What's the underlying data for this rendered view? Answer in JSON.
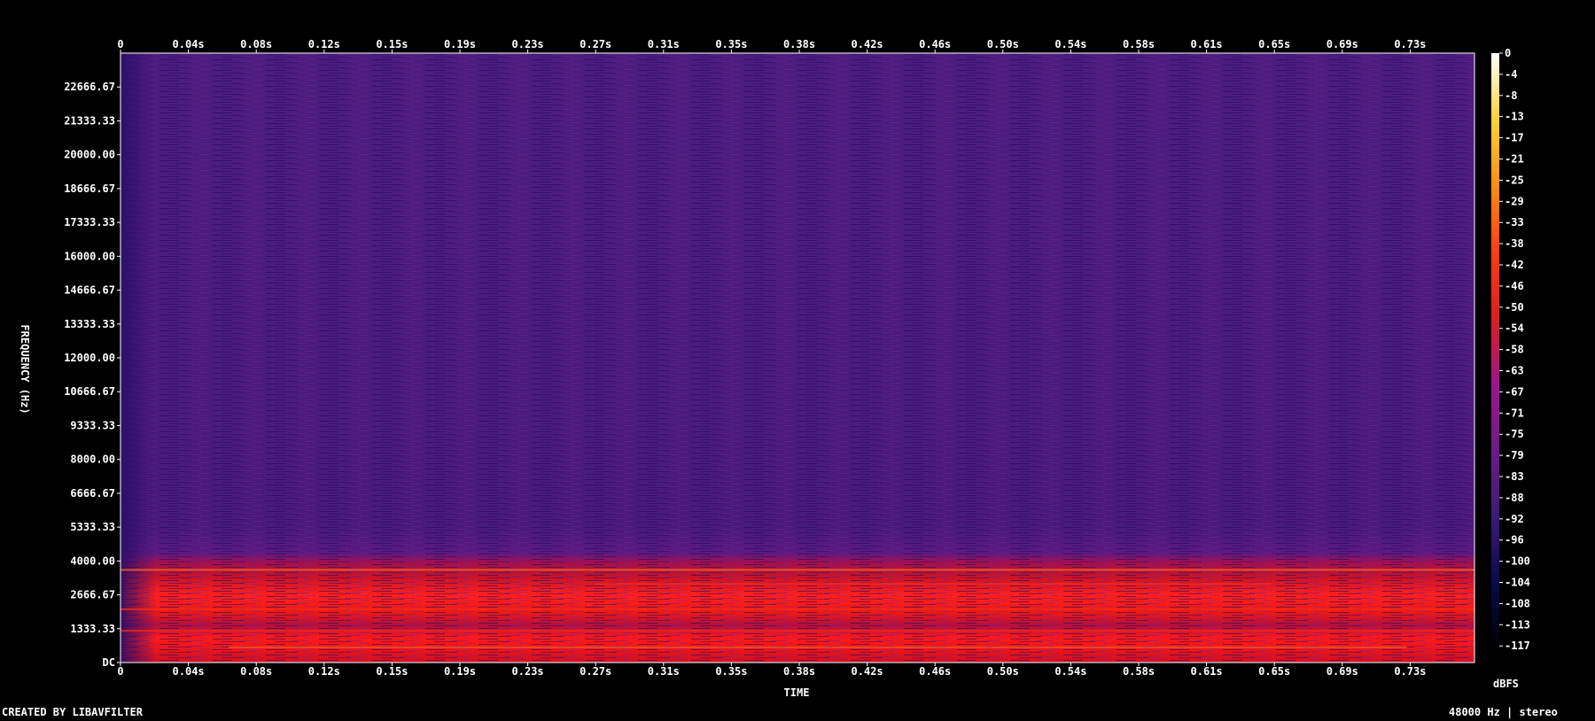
{
  "chart_data": {
    "type": "heatmap",
    "title": "",
    "xlabel": "TIME",
    "ylabel": "FREQUENCY (Hz)",
    "x_ticks": [
      "0",
      "0.04s",
      "0.08s",
      "0.12s",
      "0.15s",
      "0.19s",
      "0.23s",
      "0.27s",
      "0.31s",
      "0.35s",
      "0.38s",
      "0.42s",
      "0.46s",
      "0.50s",
      "0.54s",
      "0.58s",
      "0.61s",
      "0.65s",
      "0.69s",
      "0.73s"
    ],
    "y_ticks": [
      "DC",
      "1333.33",
      "2666.67",
      "4000.00",
      "5333.33",
      "6666.67",
      "8000.00",
      "9333.33",
      "10666.67",
      "12000.00",
      "13333.33",
      "14666.67",
      "16000.00",
      "17333.33",
      "18666.67",
      "20000.00",
      "21333.33",
      "22666.67"
    ],
    "y_range_hz": [
      0,
      24000
    ],
    "colorbar_label": "dBFS",
    "colorbar_ticks": [
      "0",
      "-4",
      "-8",
      "-13",
      "-17",
      "-21",
      "-25",
      "-29",
      "-33",
      "-38",
      "-42",
      "-46",
      "-50",
      "-54",
      "-58",
      "-63",
      "-67",
      "-71",
      "-75",
      "-79",
      "-83",
      "-88",
      "-92",
      "-96",
      "-100",
      "-104",
      "-108",
      "-113",
      "-117"
    ],
    "colorbar_range_dbfs": [
      -120,
      0
    ],
    "colormap": [
      "#000000",
      "#0a0850",
      "#3c1a78",
      "#6e1a8c",
      "#a0148c",
      "#dc1e1e",
      "#ff3c14",
      "#ff8c14",
      "#ffd232",
      "#ffffff"
    ],
    "energy_bands_hz": [
      {
        "from": 0,
        "to": 1000,
        "level_dbfs": -50
      },
      {
        "from": 1000,
        "to": 1500,
        "level_dbfs": -52
      },
      {
        "from": 1500,
        "to": 4000,
        "level_dbfs": -55
      },
      {
        "from": 4000,
        "to": 5300,
        "level_dbfs": -85
      },
      {
        "from": 5300,
        "to": 24000,
        "level_dbfs": -94
      }
    ]
  },
  "footer": {
    "left": "CREATED BY LIBAVFILTER",
    "right": "48000 Hz | stereo"
  }
}
